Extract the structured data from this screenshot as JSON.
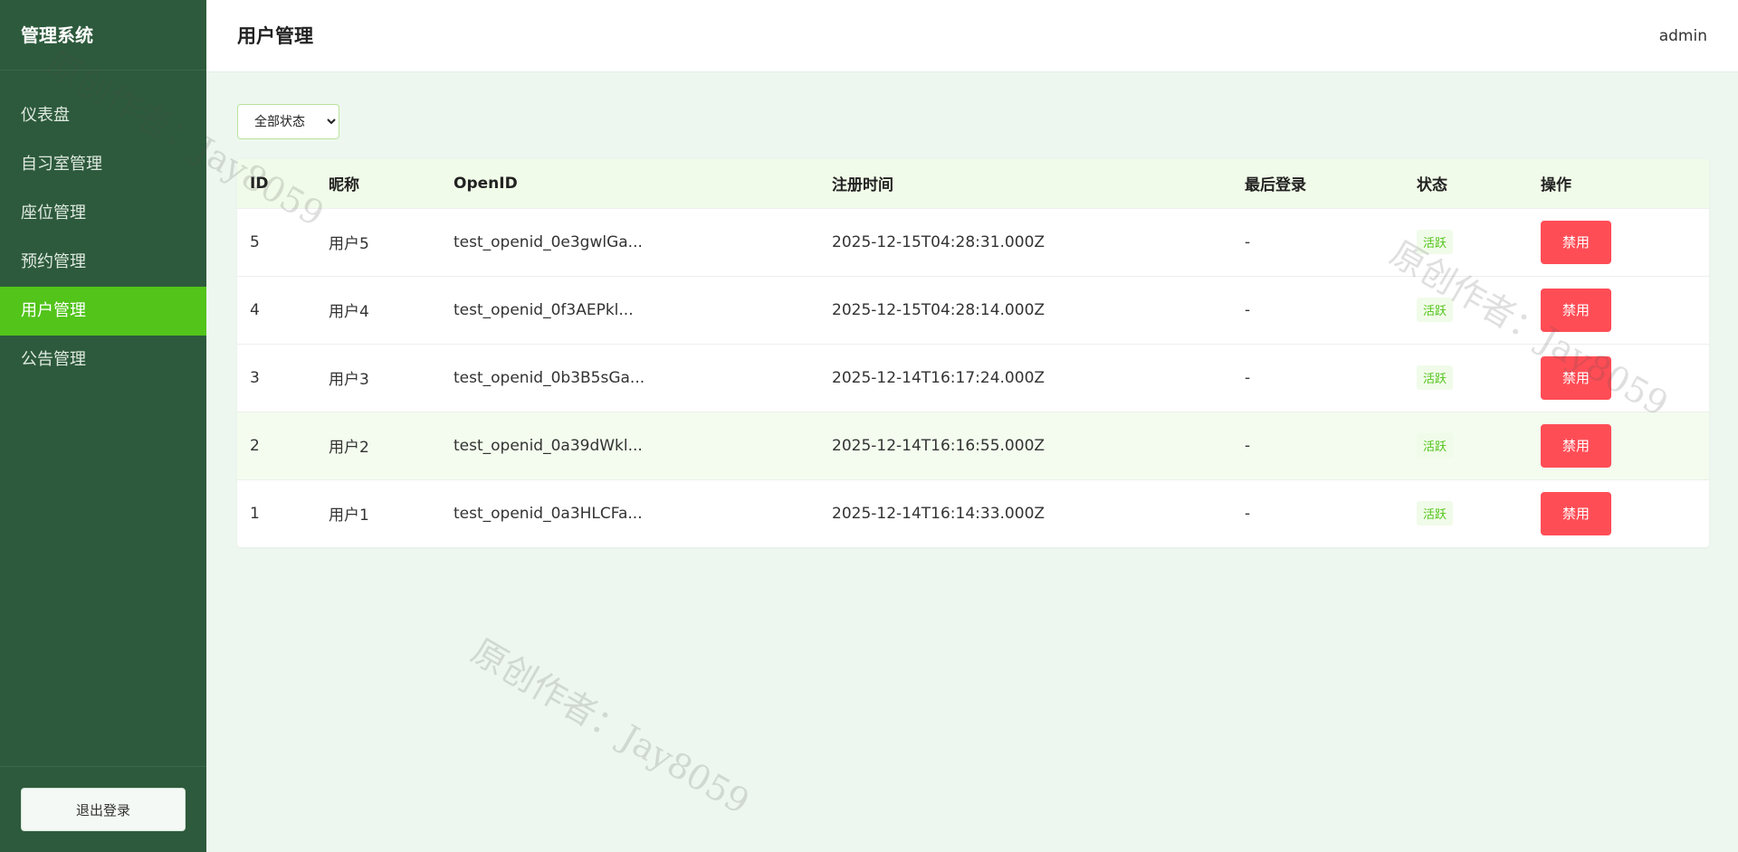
{
  "app": {
    "brand": "管理系统",
    "page_title": "用户管理",
    "current_user": "admin"
  },
  "sidebar": {
    "items": [
      {
        "label": "仪表盘",
        "active": false
      },
      {
        "label": "自习室管理",
        "active": false
      },
      {
        "label": "座位管理",
        "active": false
      },
      {
        "label": "预约管理",
        "active": false
      },
      {
        "label": "用户管理",
        "active": true
      },
      {
        "label": "公告管理",
        "active": false
      }
    ],
    "logout_label": "退出登录"
  },
  "filter": {
    "selected": "全部状态"
  },
  "table": {
    "columns": [
      "ID",
      "昵称",
      "OpenID",
      "注册时间",
      "最后登录",
      "状态",
      "操作"
    ],
    "rows": [
      {
        "id": "5",
        "nickname": "用户5",
        "openid": "test_openid_0e3gwlGa...",
        "registered": "2025-12-15T04:28:31.000Z",
        "last_login": "-",
        "status": "活跃",
        "action": "禁用"
      },
      {
        "id": "4",
        "nickname": "用户4",
        "openid": "test_openid_0f3AEPkl...",
        "registered": "2025-12-15T04:28:14.000Z",
        "last_login": "-",
        "status": "活跃",
        "action": "禁用"
      },
      {
        "id": "3",
        "nickname": "用户3",
        "openid": "test_openid_0b3B5sGa...",
        "registered": "2025-12-14T16:17:24.000Z",
        "last_login": "-",
        "status": "活跃",
        "action": "禁用"
      },
      {
        "id": "2",
        "nickname": "用户2",
        "openid": "test_openid_0a39dWkl...",
        "registered": "2025-12-14T16:16:55.000Z",
        "last_login": "-",
        "status": "活跃",
        "action": "禁用"
      },
      {
        "id": "1",
        "nickname": "用户1",
        "openid": "test_openid_0a3HLCFa...",
        "registered": "2025-12-14T16:14:33.000Z",
        "last_login": "-",
        "status": "活跃",
        "action": "禁用"
      }
    ]
  },
  "watermark": "原创作者：Jay8059",
  "colors": {
    "sidebar_bg": "#2d5a3c",
    "accent": "#52c41a",
    "danger": "#ff4d56",
    "page_bg": "#eef7ef"
  }
}
